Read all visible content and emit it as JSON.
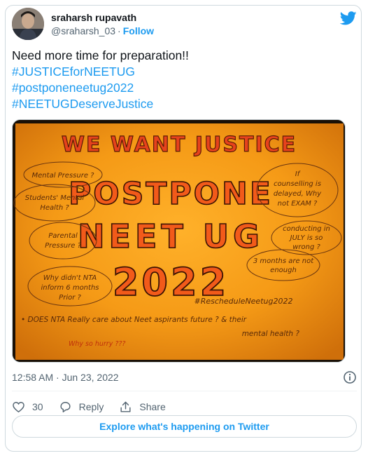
{
  "author": {
    "name": "sraharsh rupavath",
    "handle": "@sraharsh_03",
    "separator": "·",
    "follow_label": "Follow"
  },
  "tweet": {
    "text": "Need more time for preparation!!",
    "hashtags": [
      "#JUSTICEforNEETUG",
      "#postponeneetug2022",
      "#NEETUGDeserveJustice"
    ]
  },
  "poster": {
    "headline": "WE WANT JUSTICE",
    "line1": "POSTPONE",
    "line2": "NEET UG",
    "line3": "2022",
    "clouds": {
      "mental": "Mental Pressure ?",
      "students_1": "Students' Mental",
      "students_2": "Health ?",
      "parental_1": "Parental",
      "parental_2": "Pressure ?",
      "nta_1": "Why didn't NTA",
      "nta_2": "inform 6 months",
      "nta_3": "Prior ?",
      "counselling_1": "If",
      "counselling_2": "counselling is",
      "counselling_3": "delayed, Why",
      "counselling_4": "not EXAM ?",
      "july_1": "conducting in",
      "july_2": "JULY is so",
      "july_3": "wrong ?",
      "months_1": "3 months are not",
      "months_2": "enough"
    },
    "reschedule_tag": "#RescheduleNeetug2022",
    "bottom_line_1": "• DOES NTA Really care about Neet aspirants future ? & their",
    "bottom_line_2": "mental health ?",
    "hurry": "Why so hurry ???"
  },
  "meta": {
    "time": "12:58 AM · Jun 23, 2022"
  },
  "actions": {
    "like_count": "30",
    "reply_label": "Reply",
    "share_label": "Share"
  },
  "explore_label": "Explore what's happening on Twitter",
  "colors": {
    "accent": "#1d9bf0",
    "text": "#0f1419",
    "muted": "#536471",
    "border": "#cfd9de"
  }
}
